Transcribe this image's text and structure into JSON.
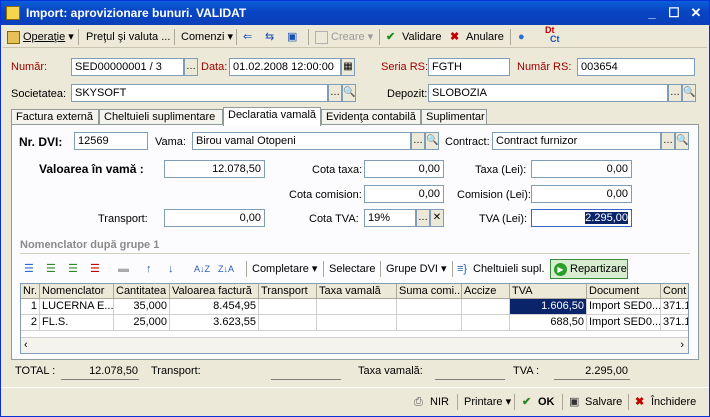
{
  "window": {
    "title": "Import: aprovizionare bunuri. VALIDAT"
  },
  "toolbar": {
    "operatie": "Operaţie",
    "pretul": "Preţul şi valuta ...",
    "comenzi": "Comenzi",
    "creare": "Creare",
    "validare": "Validare",
    "anulare": "Anulare",
    "dt_top": "Dt",
    "dt_bottom": "Ct"
  },
  "header": {
    "numar_label": "Număr:",
    "numar_value": "SED00000001 / 3",
    "data_label": "Data:",
    "data_value": "01.02.2008 12:00:00",
    "seria_label": "Seria RS:",
    "seria_value": "FGTH",
    "numar_rs_label": "Număr RS:",
    "numar_rs_value": "003654",
    "societatea_label": "Societatea:",
    "societatea_value": "SKYSOFT",
    "depozit_label": "Depozit:",
    "depozit_value": "SLOBOZIA"
  },
  "tabs": [
    "Factura externă",
    "Cheltuieli suplimentare",
    "Declaratia vamală",
    "Evidenţa contabilă",
    "Suplimentar"
  ],
  "dvi": {
    "nr_label": "Nr. DVI:",
    "nr_value": "12569",
    "vama_label": "Vama:",
    "vama_value": "Birou vamal Otopeni",
    "contract_label": "Contract:",
    "contract_value": "Contract furnizor",
    "valoarea_label": "Valoarea în vamă :",
    "valoarea_value": "12.078,50",
    "cota_taxa_label": "Cota taxa:",
    "cota_taxa_value": "0,00",
    "taxa_lei_label": "Taxa (Lei):",
    "taxa_lei_value": "0,00",
    "cota_comision_label": "Cota comision:",
    "cota_comision_value": "0,00",
    "comision_lei_label": "Comision (Lei):",
    "comision_lei_value": "0,00",
    "transport_label": "Transport:",
    "transport_value": "0,00",
    "cota_tva_label": "Cota TVA:",
    "cota_tva_value": "19%",
    "tva_lei_label": "TVA (Lei):",
    "tva_lei_value": "2.295,00"
  },
  "group": {
    "title": "Nomenclator după grupe 1",
    "completare": "Completare",
    "selectare": "Selectare",
    "grupe_dvi": "Grupe DVI",
    "cheltuieli": "Cheltuieli supl.",
    "repartizare": "Repartizare"
  },
  "grid": {
    "columns": [
      "Nr.",
      "Nomenclator",
      "Cantitatea",
      "Valoarea factură",
      "Transport",
      "Taxa vamală",
      "Suma comi...",
      "Accize",
      "TVA",
      "Document",
      "Cont e"
    ],
    "rows": [
      [
        "1",
        "LUCERNA E...",
        "35,000",
        "8.454,95",
        "",
        "",
        "",
        "",
        "1.606,50",
        "Import SED0...",
        "371.1"
      ],
      [
        "2",
        "FL.S.",
        "25,000",
        "3.623,55",
        "",
        "",
        "",
        "",
        "688,50",
        "Import SED0...",
        "371.1"
      ]
    ]
  },
  "totals": {
    "total_label": "TOTAL :",
    "total_value": "12.078,50",
    "transport_label": "Transport:",
    "transport_value": "",
    "taxa_label": "Taxa vamală:",
    "taxa_value": "",
    "tva_label": "TVA :",
    "tva_value": "2.295,00"
  },
  "footer": {
    "nir": "NIR",
    "printare": "Printare",
    "ok": "OK",
    "salvare": "Salvare",
    "inchidere": "Închidere"
  }
}
